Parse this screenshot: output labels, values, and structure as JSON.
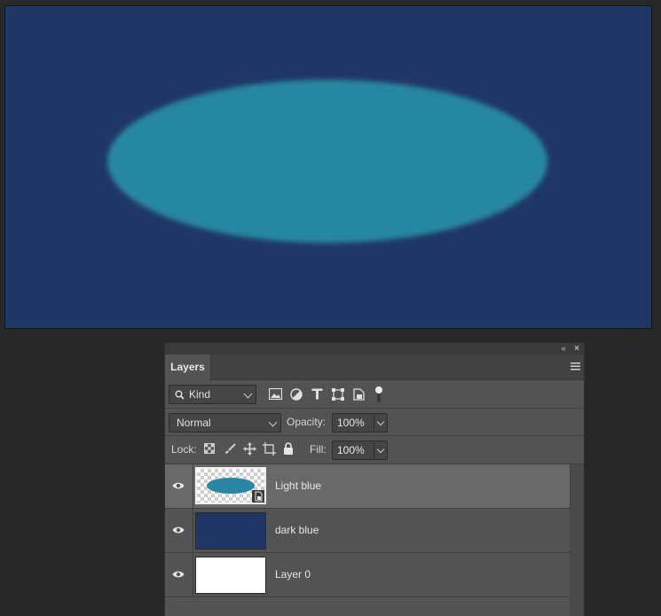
{
  "document": {
    "background_color": "#203766",
    "ellipse_color": "#2887a2"
  },
  "layers_panel": {
    "tab_label": "Layers",
    "collapse_glyph": "«",
    "close_glyph": "×",
    "filter": {
      "kind_label": "Kind",
      "icons": [
        "pixel-filter-icon",
        "adjustment-filter-icon",
        "type-filter-icon",
        "shape-filter-icon",
        "smart-object-filter-icon",
        "filter-toggle-icon"
      ]
    },
    "blend_mode": "Normal",
    "opacity_label": "Opacity:",
    "opacity_value": "100%",
    "lock_label": "Lock:",
    "lock_icons": [
      "lock-transparent-icon",
      "lock-image-icon",
      "lock-position-icon",
      "lock-artboard-icon",
      "lock-all-icon"
    ],
    "fill_label": "Fill:",
    "fill_value": "100%",
    "layers": [
      {
        "name": "Light blue",
        "selected": true,
        "visible": true,
        "thumb": "transparent-with-ellipse",
        "smart_object": true
      },
      {
        "name": "dark blue",
        "selected": false,
        "visible": true,
        "thumb_color": "#203766"
      },
      {
        "name": "Layer 0",
        "selected": false,
        "visible": true,
        "thumb_color": "#ffffff"
      }
    ]
  }
}
